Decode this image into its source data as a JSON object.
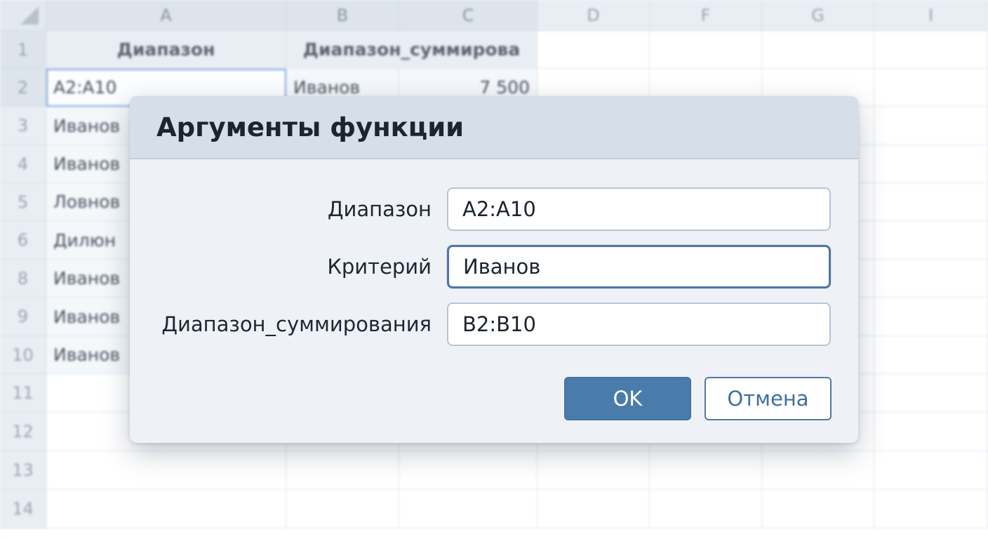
{
  "spreadsheet": {
    "column_headers": [
      "A",
      "B",
      "C",
      "D",
      "F",
      "G",
      "I"
    ],
    "row_headers": [
      "1",
      "2",
      "3",
      "4",
      "5",
      "6",
      "8",
      "9",
      "10",
      "11",
      "12",
      "13",
      "14"
    ],
    "header_row": {
      "a": "Диапазон",
      "bc": "Диапазон_суммирова"
    },
    "row2": {
      "a": "A2:A10",
      "b": "Иванов",
      "c": "7 500"
    },
    "col_a_values": [
      "Иванов",
      "Иванов",
      "Ловнов",
      "Дилюн",
      "Иванов",
      "Иванов",
      "Иванов"
    ]
  },
  "dialog": {
    "title": "Аргументы функции",
    "fields": [
      {
        "label": "Диапазон",
        "value": "A2:A10"
      },
      {
        "label": "Критерий",
        "value": "Иванов"
      },
      {
        "label": "Диапазон_суммирования",
        "value": "B2:B10"
      }
    ],
    "ok_label": "OK",
    "cancel_label": "Отмена"
  }
}
